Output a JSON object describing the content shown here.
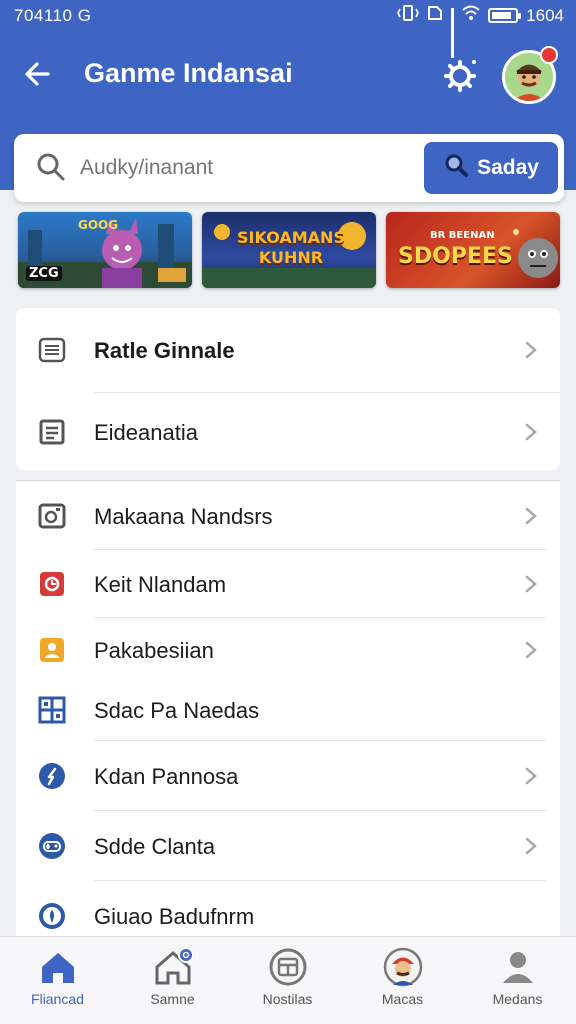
{
  "status_bar": {
    "left": "704110 G",
    "time": "1604",
    "battery_level": 0.85
  },
  "header": {
    "title": "Ganme Indansai"
  },
  "search": {
    "placeholder": "Audky/inanant",
    "button_label": "Saday"
  },
  "banners": [
    {
      "text": "GOOG",
      "art_text": "ZCG"
    },
    {
      "text": "SIKOAMANS KUHNR"
    },
    {
      "text": "SDOPEES",
      "sub": "BR BEENAN"
    }
  ],
  "group1": [
    {
      "label": "Ratle Ginnale",
      "icon": "list-icon",
      "chevron": true
    },
    {
      "label": "Eideanatia",
      "icon": "document-icon",
      "chevron": true
    }
  ],
  "group2": [
    {
      "label": "Makaana Nandsrs",
      "icon": "camera-icon",
      "chevron": true
    },
    {
      "label": "Keit Nlandam",
      "icon": "gamepad-icon",
      "chevron": true
    },
    {
      "label": "Pakabesiian",
      "icon": "person-icon",
      "chevron": true
    },
    {
      "label": "Sdac Pa Naedas",
      "icon": "grid-icon",
      "chevron": false
    },
    {
      "label": "Kdan Pannosa",
      "icon": "compass-icon",
      "chevron": true
    },
    {
      "label": "Sdde Clanta",
      "icon": "controller-icon",
      "chevron": true
    },
    {
      "label": "Giuao Badufnrm",
      "icon": "location-icon",
      "chevron": false
    }
  ],
  "bottom_nav": [
    {
      "label": "Fliancad",
      "icon": "home-icon",
      "active": true
    },
    {
      "label": "Samne",
      "icon": "home-badge-icon",
      "active": false
    },
    {
      "label": "Nostilas",
      "icon": "window-icon",
      "active": false
    },
    {
      "label": "Macas",
      "icon": "mario-avatar-icon",
      "active": false
    },
    {
      "label": "Medans",
      "icon": "person-icon",
      "active": false
    }
  ],
  "colors": {
    "primary": "#3f65c4",
    "background": "#eef0f4",
    "notification": "#e53935"
  }
}
